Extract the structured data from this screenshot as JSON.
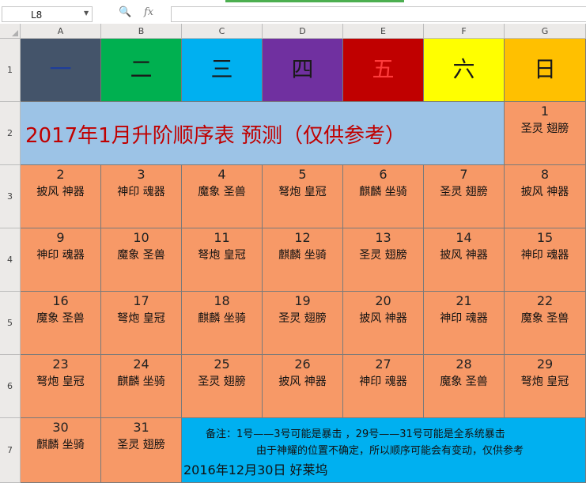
{
  "formula_bar": {
    "cell_ref": "L8",
    "fx": "fx"
  },
  "columns": [
    "A",
    "B",
    "C",
    "D",
    "E",
    "F",
    "G"
  ],
  "rows": [
    "1",
    "2",
    "3",
    "4",
    "5",
    "6",
    "7"
  ],
  "weekdays": [
    {
      "label": "一",
      "bg": "#44546a",
      "fg": "#1f3d99"
    },
    {
      "label": "二",
      "bg": "#00b050",
      "fg": "#1a1a1a"
    },
    {
      "label": "三",
      "bg": "#00b0f0",
      "fg": "#1a1a1a"
    },
    {
      "label": "四",
      "bg": "#7030a0",
      "fg": "#1a1a1a"
    },
    {
      "label": "五",
      "bg": "#c00000",
      "fg": "#ff3b3b"
    },
    {
      "label": "六",
      "bg": "#ffff00",
      "fg": "#1a1a1a"
    },
    {
      "label": "日",
      "bg": "#ffc000",
      "fg": "#1a1a1a"
    }
  ],
  "title": "2017年1月升阶顺序表    预测（仅供参考）",
  "day_bg": "#f79967",
  "days": [
    {
      "d": "1",
      "t": "圣灵 翅膀"
    },
    {
      "d": "2",
      "t": "披风 神器"
    },
    {
      "d": "3",
      "t": "神印 魂器"
    },
    {
      "d": "4",
      "t": "魔象 圣兽"
    },
    {
      "d": "5",
      "t": "弩炮 皇冠"
    },
    {
      "d": "6",
      "t": "麒麟 坐骑"
    },
    {
      "d": "7",
      "t": "圣灵 翅膀"
    },
    {
      "d": "8",
      "t": "披风 神器"
    },
    {
      "d": "9",
      "t": "神印 魂器"
    },
    {
      "d": "10",
      "t": "魔象 圣兽"
    },
    {
      "d": "11",
      "t": "弩炮 皇冠"
    },
    {
      "d": "12",
      "t": "麒麟 坐骑"
    },
    {
      "d": "13",
      "t": "圣灵 翅膀"
    },
    {
      "d": "14",
      "t": "披风 神器"
    },
    {
      "d": "15",
      "t": "神印 魂器"
    },
    {
      "d": "16",
      "t": "魔象 圣兽"
    },
    {
      "d": "17",
      "t": "弩炮 皇冠"
    },
    {
      "d": "18",
      "t": "麒麟 坐骑"
    },
    {
      "d": "19",
      "t": "圣灵 翅膀"
    },
    {
      "d": "20",
      "t": "披风 神器"
    },
    {
      "d": "21",
      "t": "神印 魂器"
    },
    {
      "d": "22",
      "t": "魔象 圣兽"
    },
    {
      "d": "23",
      "t": "弩炮 皇冠"
    },
    {
      "d": "24",
      "t": "麒麟 坐骑"
    },
    {
      "d": "25",
      "t": "圣灵 翅膀"
    },
    {
      "d": "26",
      "t": "披风 神器"
    },
    {
      "d": "27",
      "t": "神印 魂器"
    },
    {
      "d": "28",
      "t": "魔象 圣兽"
    },
    {
      "d": "29",
      "t": "弩炮 皇冠"
    },
    {
      "d": "30",
      "t": "麒麟 坐骑"
    },
    {
      "d": "31",
      "t": "圣灵 翅膀"
    }
  ],
  "note": {
    "line1": "备注：1号——3号可能是暴击 ，29号——31号可能是全系统暴击",
    "line2": "由于神耀的位置不确定，所以顺序可能会有变动，仅供参考",
    "line3": "2016年12月30日 好莱坞"
  }
}
